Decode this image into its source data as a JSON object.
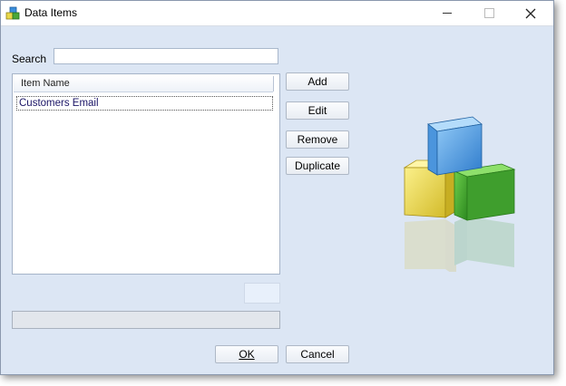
{
  "window": {
    "title": "Data Items"
  },
  "icons": {
    "app": "data-items-cubes-icon",
    "minimize": "minimize-icon",
    "maximize": "maximize-icon",
    "close": "close-icon",
    "graphic": "cubes-illustration"
  },
  "search": {
    "label": "Search",
    "value": "",
    "placeholder": ""
  },
  "list": {
    "column_header": "Item Name",
    "items": [
      "Customers Email"
    ]
  },
  "buttons": {
    "add": "Add",
    "edit": "Edit",
    "remove": "Remove",
    "duplicate": "Duplicate",
    "ok": "OK",
    "cancel": "Cancel"
  },
  "progress": {
    "fraction": 0
  },
  "colors": {
    "dialog_background": "#dce6f4",
    "cube_blue": "#3b8fdc",
    "cube_yellow": "#e9d84a",
    "cube_green": "#3a9a2a"
  }
}
